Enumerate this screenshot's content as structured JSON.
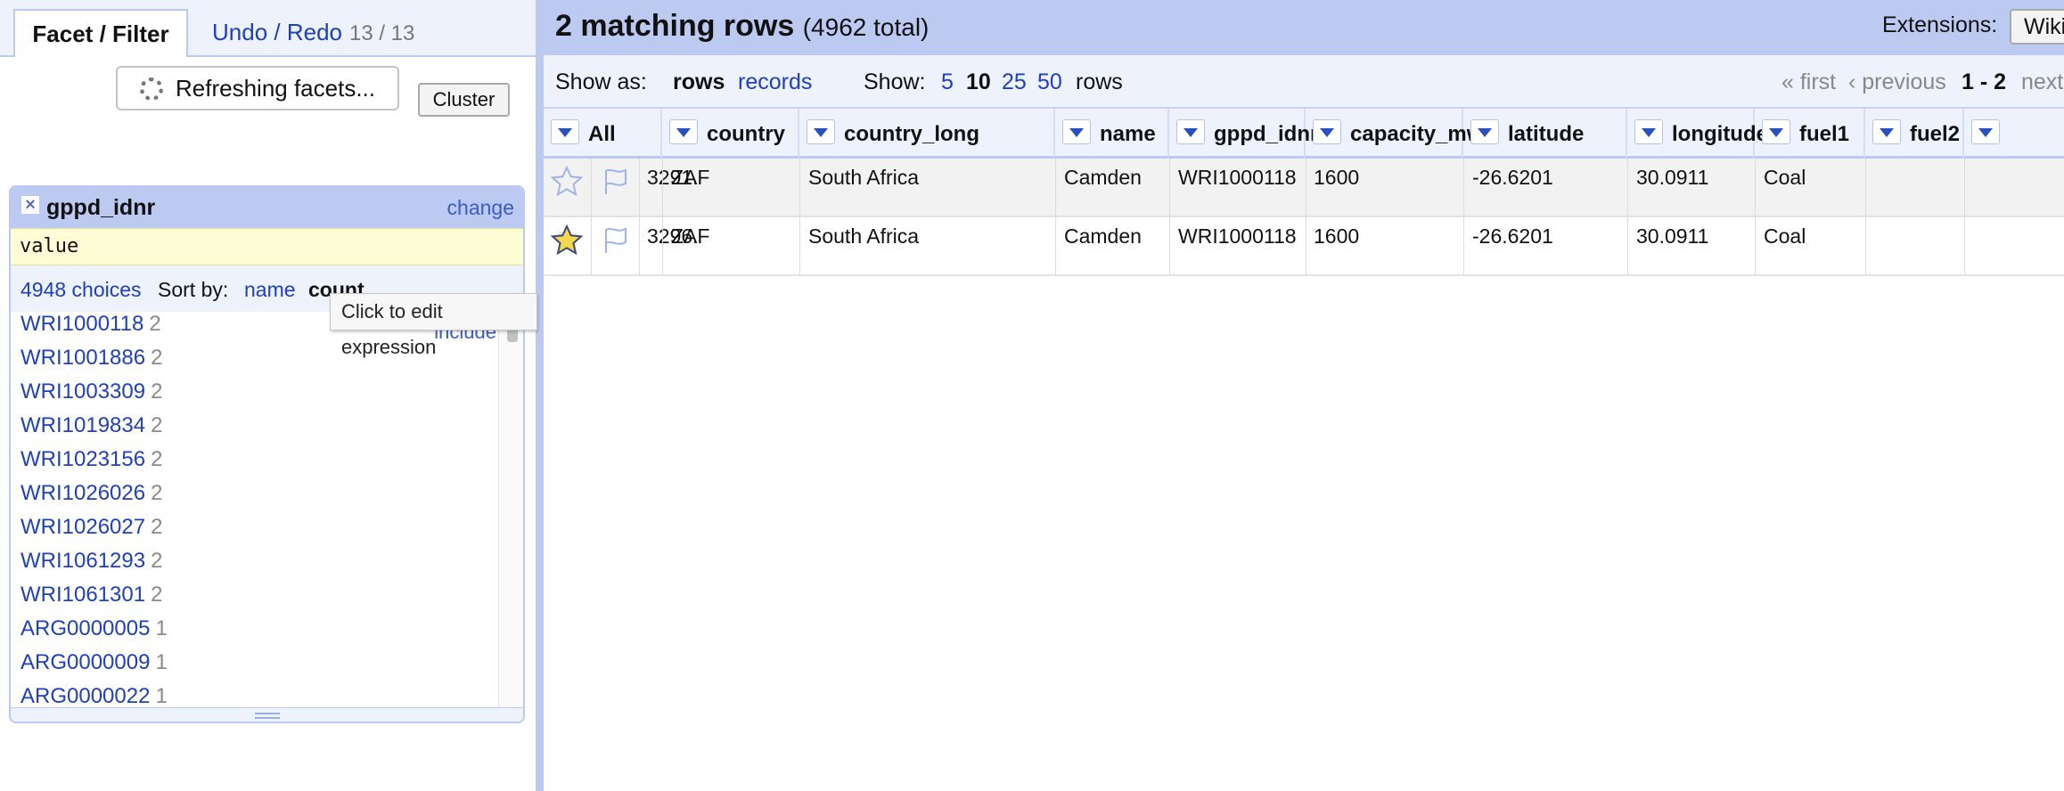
{
  "left": {
    "tabs": {
      "facet": "Facet / Filter",
      "undo": "Undo / Redo",
      "undo_counts": "13 / 13"
    },
    "refresh_label": "Refreshing facets...",
    "facet": {
      "title": "gppd_idnr",
      "change_label": "change",
      "expression": "value",
      "choices_label": "4948 choices",
      "sort_by_label": "Sort by:",
      "sort_name": "name",
      "sort_count": "count",
      "cluster_label": "Cluster",
      "include_label": "include",
      "items": [
        {
          "name": "WRI1000118",
          "count": "2"
        },
        {
          "name": "WRI1001886",
          "count": "2"
        },
        {
          "name": "WRI1003309",
          "count": "2"
        },
        {
          "name": "WRI1019834",
          "count": "2"
        },
        {
          "name": "WRI1023156",
          "count": "2"
        },
        {
          "name": "WRI1026026",
          "count": "2"
        },
        {
          "name": "WRI1026027",
          "count": "2"
        },
        {
          "name": "WRI1061293",
          "count": "2"
        },
        {
          "name": "WRI1061301",
          "count": "2"
        },
        {
          "name": "ARG0000005",
          "count": "1"
        },
        {
          "name": "ARG0000009",
          "count": "1"
        },
        {
          "name": "ARG0000022",
          "count": "1"
        }
      ]
    },
    "tooltip": "Click to edit expression"
  },
  "right": {
    "summary": {
      "matching": "2 matching rows",
      "total": "(4962 total)"
    },
    "extensions_label": "Extensions:",
    "extensions_button": "Wiki",
    "view": {
      "show_as": "Show as:",
      "rows": "rows",
      "records": "records",
      "show": "Show:",
      "sizes": [
        "5",
        "10",
        "25",
        "50"
      ],
      "rows_suffix": "rows",
      "first": "« first",
      "previous": "‹ previous",
      "range": "1 - 2",
      "next": "next"
    },
    "columns": [
      "All",
      "country",
      "country_long",
      "name",
      "gppd_idnr",
      "capacity_mw",
      "latitude",
      "longitude",
      "fuel1",
      "fuel2"
    ],
    "rows": [
      {
        "starred": false,
        "index": "3291.",
        "cells": [
          "ZAF",
          "South Africa",
          "Camden",
          "WRI1000118",
          "1600",
          "-26.6201",
          "30.0911",
          "Coal",
          ""
        ]
      },
      {
        "starred": true,
        "index": "3296.",
        "cells": [
          "ZAF",
          "South Africa",
          "Camden",
          "WRI1000118",
          "1600",
          "-26.6201",
          "30.0911",
          "Coal",
          ""
        ]
      }
    ],
    "colors": {
      "star_fill": "#f2d84a",
      "header_bg": "#bccaf2",
      "link": "#1e3fbf"
    }
  }
}
